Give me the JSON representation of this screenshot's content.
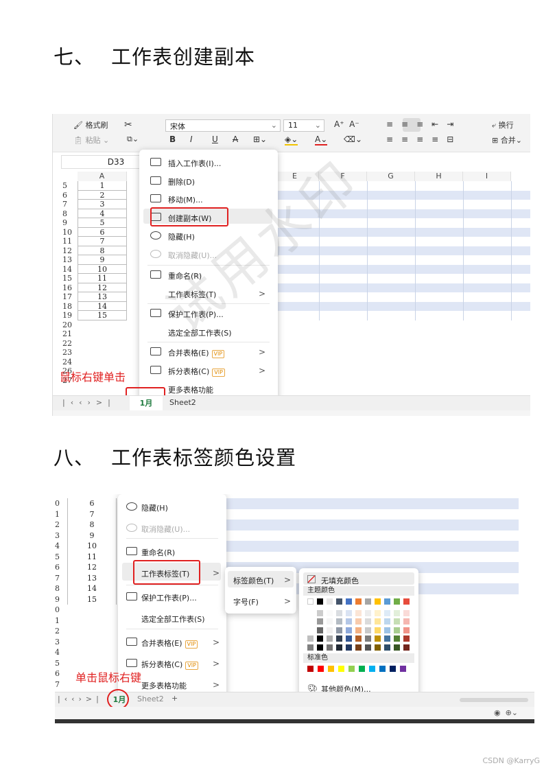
{
  "section7": {
    "num": "七、",
    "title": "工作表创建副本"
  },
  "section8": {
    "num": "八、",
    "title": "工作表标签颜色设置"
  },
  "shot1": {
    "ribbon": {
      "format_painter": "格式刷",
      "paste": "粘贴",
      "font_name": "宋体",
      "font_size": "11",
      "bold": "B",
      "italic": "I",
      "underline": "U",
      "strike": "A",
      "wrap": "换行",
      "merge": "合并"
    },
    "name_box": "D33",
    "columns": [
      "A",
      "E",
      "F",
      "G",
      "H",
      "I"
    ],
    "rows": [
      {
        "n": "5",
        "v": "1"
      },
      {
        "n": "6",
        "v": "2"
      },
      {
        "n": "7",
        "v": "3"
      },
      {
        "n": "8",
        "v": "4"
      },
      {
        "n": "9",
        "v": "5"
      },
      {
        "n": "10",
        "v": "6"
      },
      {
        "n": "11",
        "v": "7"
      },
      {
        "n": "12",
        "v": "8"
      },
      {
        "n": "13",
        "v": "9"
      },
      {
        "n": "14",
        "v": "10"
      },
      {
        "n": "15",
        "v": "11"
      },
      {
        "n": "16",
        "v": "12"
      },
      {
        "n": "17",
        "v": "13"
      },
      {
        "n": "18",
        "v": "14"
      },
      {
        "n": "19",
        "v": "15"
      },
      {
        "n": "20",
        "v": ""
      },
      {
        "n": "21",
        "v": ""
      },
      {
        "n": "22",
        "v": ""
      },
      {
        "n": "23",
        "v": ""
      },
      {
        "n": "24",
        "v": ""
      },
      {
        "n": "26",
        "v": ""
      },
      {
        "n": "27",
        "v": ""
      }
    ],
    "menu": {
      "insert": "插入工作表(I)...",
      "delete": "删除(D)",
      "move": "移动(M)...",
      "copy": "创建副本(W)",
      "hide": "隐藏(H)",
      "unhide": "取消隐藏(U)...",
      "rename": "重命名(R)",
      "tab": "工作表标签(T)",
      "protect": "保护工作表(P)...",
      "select_all": "选定全部工作表(S)",
      "merge_tables": "合并表格(E)",
      "split_tables": "拆分表格(C)",
      "more": "更多表格功能",
      "vip": "VIP"
    },
    "annotation": "鼠标右键单击",
    "tabs": {
      "active": "1月",
      "other": "Sheet2"
    }
  },
  "shot2": {
    "rows": [
      {
        "n": "0",
        "v": "6"
      },
      {
        "n": "1",
        "v": "7"
      },
      {
        "n": "2",
        "v": "8"
      },
      {
        "n": "3",
        "v": "9"
      },
      {
        "n": "4",
        "v": "10"
      },
      {
        "n": "5",
        "v": "11"
      },
      {
        "n": "6",
        "v": "12"
      },
      {
        "n": "7",
        "v": "13"
      },
      {
        "n": "8",
        "v": "14"
      },
      {
        "n": "9",
        "v": "15"
      },
      {
        "n": "0",
        "v": ""
      },
      {
        "n": "1",
        "v": ""
      },
      {
        "n": "2",
        "v": ""
      },
      {
        "n": "3",
        "v": ""
      },
      {
        "n": "4",
        "v": ""
      },
      {
        "n": "5",
        "v": ""
      },
      {
        "n": "6",
        "v": ""
      },
      {
        "n": "7",
        "v": ""
      }
    ],
    "menu": {
      "hide": "隐藏(H)",
      "unhide": "取消隐藏(U)...",
      "rename": "重命名(R)",
      "tab": "工作表标签(T)",
      "protect": "保护工作表(P)...",
      "select_all": "选定全部工作表(S)",
      "merge_tables": "合并表格(E)",
      "split_tables": "拆分表格(C)",
      "more": "更多表格功能",
      "vip": "VIP"
    },
    "submenu": {
      "tab_color": "标签颜色(T)",
      "font_size": "字号(F)"
    },
    "palette": {
      "no_fill": "无填充颜色",
      "theme": "主题颜色",
      "standard": "标准色",
      "more": "其他颜色(M)...",
      "theme_top": [
        "#ffffff",
        "#000000",
        "#e7e6e6",
        "#44546a",
        "#4472c4",
        "#ed7d31",
        "#a5a5a5",
        "#ffc000",
        "#5b9bd5",
        "#70ad47",
        "#e74c3c"
      ],
      "standard_colors": [
        "#c00000",
        "#ff0000",
        "#ffc000",
        "#ffff00",
        "#92d050",
        "#00b050",
        "#00b0f0",
        "#0070c0",
        "#002060",
        "#7030a0"
      ]
    },
    "annotation": "单击鼠标右键",
    "tabs": {
      "active": "1月",
      "other": "Sheet2",
      "add": "+"
    }
  },
  "watermark": "试用水印",
  "footer": "CSDN @KarryG"
}
